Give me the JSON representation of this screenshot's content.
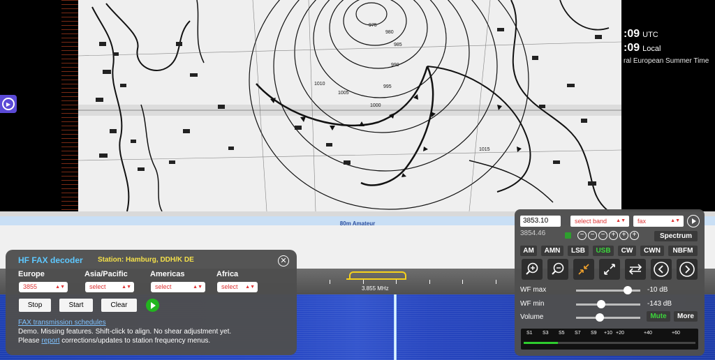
{
  "clock": {
    "utc_time": ":09",
    "utc_label": "UTC",
    "local_time": ":09",
    "local_label": "Local",
    "timezone": "ral European Summer Time"
  },
  "band": {
    "label": "80m Amateur"
  },
  "scale": {
    "marker": "3.855 MHz"
  },
  "fax_decoder": {
    "title": "HF FAX decoder",
    "station": "Station: Hamburg, DDH/K DE",
    "regions": [
      {
        "label": "Europe",
        "value": "3855"
      },
      {
        "label": "Asia/Pacific",
        "value": "select"
      },
      {
        "label": "Americas",
        "value": "select"
      },
      {
        "label": "Africa",
        "value": "select"
      }
    ],
    "buttons": {
      "stop": "Stop",
      "start": "Start",
      "clear": "Clear"
    },
    "schedules_link": "FAX transmission schedules",
    "note_line1": "Demo. Missing features. Shift-click to align. No shear adjustment yet.",
    "note_line2_pre": "Please ",
    "note_link": "report",
    "note_line2_post": " corrections/updates to station frequency menus."
  },
  "fax_map": {
    "isobar_labels": [
      "975",
      "980",
      "985",
      "990",
      "995",
      "1000",
      "1005",
      "1010",
      "1015"
    ]
  },
  "controls": {
    "frequency": "3853.10",
    "band_select": "select band",
    "mode_select": "fax",
    "sub_freq": "3854.46",
    "spectrum": "Spectrum",
    "modes": [
      "AM",
      "AMN",
      "LSB",
      "USB",
      "CW",
      "CWN",
      "NBFM"
    ],
    "active_mode": "USB",
    "wf_max_label": "WF max",
    "wf_max_value": "-10 dB",
    "wf_max_level": 0.85,
    "wf_min_label": "WF min",
    "wf_min_value": "-143 dB",
    "wf_min_level": 0.38,
    "volume_label": "Volume",
    "volume_level": 0.35,
    "mute": "Mute",
    "more": "More",
    "smeter_labels": [
      "S1",
      "S3",
      "S5",
      "S7",
      "S9",
      "+10",
      "+20",
      "+40",
      "+60"
    ],
    "smeter_level": 0.2
  },
  "colors": {
    "accent": "#5ec8ff",
    "station": "#f4e04a",
    "play": "#22b51f",
    "usb_active": "#3cd43c"
  }
}
